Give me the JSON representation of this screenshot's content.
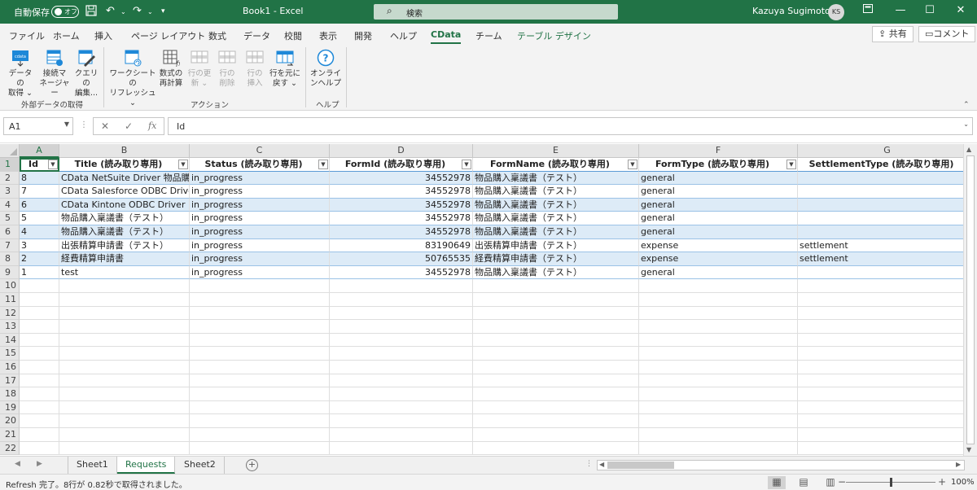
{
  "titlebar": {
    "autosave_label": "自動保存",
    "autosave_state": "オフ",
    "window_title": "Book1  -  Excel",
    "search_placeholder": "検索",
    "user_name": "Kazuya Sugimoto",
    "user_initials": "KS"
  },
  "menu": {
    "tabs": [
      "ファイル",
      "ホーム",
      "挿入",
      "ページ レイアウト",
      "数式",
      "データ",
      "校閲",
      "表示",
      "開発",
      "ヘルプ",
      "CData",
      "チーム",
      "テーブル デザイン"
    ],
    "active_tab": "CData",
    "share_label": "共有",
    "comment_label": "コメント"
  },
  "ribbon": {
    "groups": [
      {
        "label": "外部データの取得",
        "buttons": [
          {
            "l1": "データの",
            "l2": "取得 ⌄",
            "enabled": true
          },
          {
            "l1": "接続マ",
            "l2": "ネージャー",
            "enabled": true
          },
          {
            "l1": "クエリの",
            "l2": "編集...",
            "enabled": true
          }
        ]
      },
      {
        "label": "アクション",
        "buttons": [
          {
            "l1": "ワークシートの",
            "l2": "リフレッシュ ⌄",
            "enabled": true
          },
          {
            "l1": "数式の",
            "l2": "再計算",
            "enabled": true
          },
          {
            "l1": "行の更",
            "l2": "新 ⌄",
            "enabled": false
          },
          {
            "l1": "行の",
            "l2": "削除",
            "enabled": false
          },
          {
            "l1": "行の",
            "l2": "挿入",
            "enabled": false
          },
          {
            "l1": "行を元に",
            "l2": "戻す ⌄",
            "enabled": true
          }
        ]
      },
      {
        "label": "ヘルプ",
        "buttons": [
          {
            "l1": "オンライ",
            "l2": "ンヘルプ",
            "enabled": true
          }
        ]
      }
    ]
  },
  "formula_bar": {
    "name_box": "A1",
    "formula": "Id"
  },
  "sheet": {
    "columns": [
      "A",
      "B",
      "C",
      "D",
      "E",
      "F",
      "G"
    ],
    "selected_column": "A",
    "selected_row": 1,
    "headers": [
      "Id",
      "Title (読み取り専用)",
      "Status (読み取り専用)",
      "FormId (読み取り専用)",
      "FormName (読み取り専用)",
      "FormType (読み取り専用)",
      "SettlementType (読み取り専用)"
    ],
    "rows": [
      [
        "8",
        "CData NetSuite Driver 物品購入",
        "in_progress",
        "34552978",
        "物品購入稟議書（テスト）",
        "general",
        ""
      ],
      [
        "7",
        "CData Salesforce ODBC Driver",
        "in_progress",
        "34552978",
        "物品購入稟議書（テスト）",
        "general",
        ""
      ],
      [
        "6",
        "CData Kintone ODBC Driver",
        "in_progress",
        "34552978",
        "物品購入稟議書（テスト）",
        "general",
        ""
      ],
      [
        "5",
        "物品購入稟議書（テスト）",
        "in_progress",
        "34552978",
        "物品購入稟議書（テスト）",
        "general",
        ""
      ],
      [
        "4",
        "物品購入稟議書（テスト）",
        "in_progress",
        "34552978",
        "物品購入稟議書（テスト）",
        "general",
        ""
      ],
      [
        "3",
        "出張精算申請書（テスト）",
        "in_progress",
        "83190649",
        "出張精算申請書（テスト）",
        "expense",
        "settlement"
      ],
      [
        "2",
        "経費精算申請書",
        "in_progress",
        "50765535",
        "経費精算申請書（テスト）",
        "expense",
        "settlement"
      ],
      [
        "1",
        "test",
        "in_progress",
        "34552978",
        "物品購入稟議書（テスト）",
        "general",
        ""
      ]
    ],
    "row_numbers": [
      "1",
      "2",
      "3",
      "4",
      "5",
      "6",
      "7",
      "8",
      "9",
      "10",
      "11",
      "12",
      "13",
      "14",
      "15",
      "16",
      "17",
      "18",
      "19",
      "20",
      "21",
      "22"
    ]
  },
  "sheet_tabs": {
    "tabs": [
      "Sheet1",
      "Requests",
      "Sheet2"
    ],
    "active": "Requests"
  },
  "status_bar": {
    "message": "Refresh 完了。8行が 0.82秒で取得されました。",
    "zoom": "100%",
    "zoom_percent": 100
  },
  "colors": {
    "excel_green": "#217346",
    "table_band": "#ddebf7",
    "table_header_border": "#5b9bd5"
  }
}
